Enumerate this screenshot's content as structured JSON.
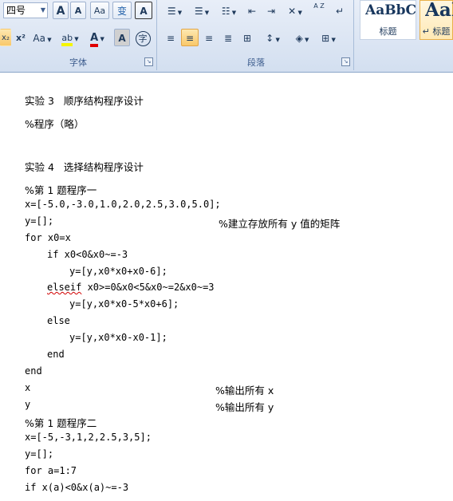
{
  "ribbon": {
    "font_group": {
      "label": "字体",
      "font_size": "四号",
      "grow_font": "A",
      "shrink_font": "A",
      "clear_format": "Aa",
      "phonetic": "变",
      "char_border": "A",
      "subscript": "x₂",
      "superscript": "x²",
      "change_case": "Aa",
      "highlight": "ab",
      "font_color": "A",
      "char_shading": "A",
      "enclose": "字"
    },
    "paragraph_group": {
      "label": "段落",
      "sort": "A Z",
      "show_marks": "↵"
    },
    "styles_group": {
      "style1_sample": "AaBbC",
      "style1_name": "标题",
      "style2_sample": "AaI",
      "style2_name": "↵ 标题"
    }
  },
  "document": {
    "lines": [
      "实验 3   顺序结构程序设计",
      "%程序（略）",
      "实验 4   选择结构程序设计",
      "%第 1 题程序一",
      "x=[-5.0,-3.0,1.0,2.0,2.5,3.0,5.0];",
      "y=[];",
      "for x0=x",
      "if x0<0&x0~=-3",
      "y=[y,x0*x0+x0-6];",
      "elseif",
      " x0>=0&x0<5&x0~=2&x0~=3",
      "y=[y,x0*x0-5*x0+6];",
      "else",
      "y=[y,x0*x0-x0-1];",
      "end",
      "end",
      "x",
      "y",
      "%第 1 题程序二",
      "x=[-5,-3,1,2,2.5,3,5];",
      "y=[];",
      "for a=1:7",
      "if x(a)<0&x(a)~=-3"
    ],
    "comments": [
      "%建立存放所有 y 值的矩阵",
      "%输出所有 x",
      "%输出所有 y"
    ]
  }
}
